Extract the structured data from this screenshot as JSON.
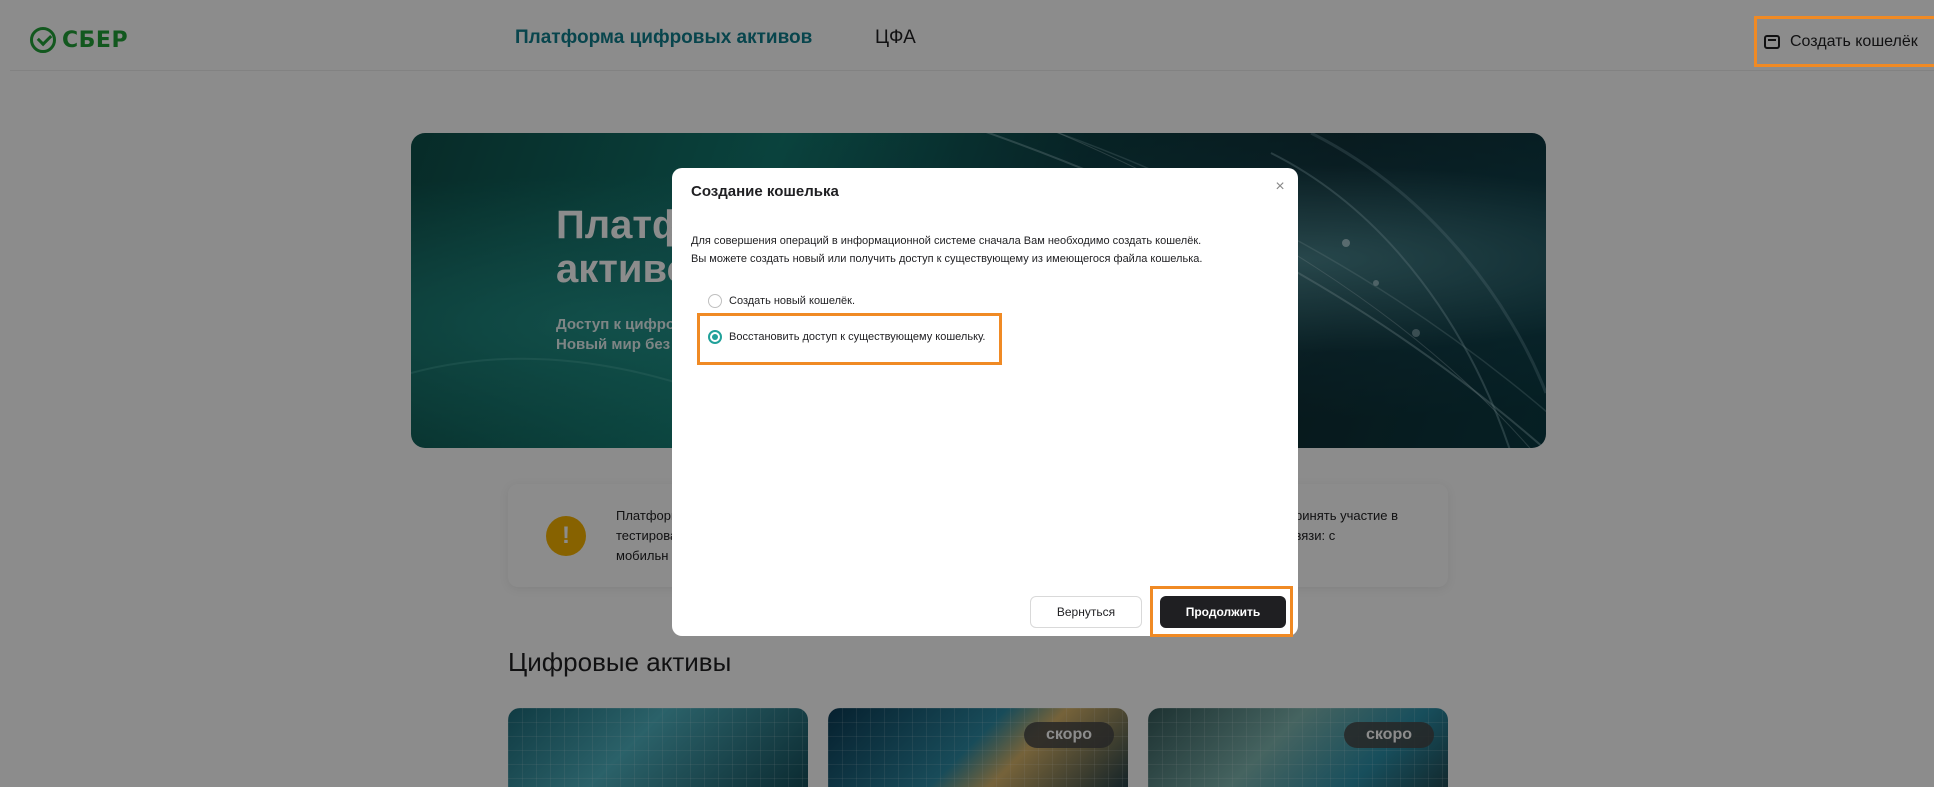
{
  "header": {
    "logo_text": "СБЕР",
    "nav_platform": "Платформа цифровых активов",
    "nav_cfa": "ЦФА",
    "create_wallet": "Создать кошелёк"
  },
  "hero": {
    "title": "Платформа цифровых\nактивов",
    "subtitle": "Доступ к цифровым активам.\nНовый мир без границ."
  },
  "notice": {
    "text_left": "Платформа\nтестирова\nмобильн",
    "text_right": "принять участие в\nсвязи: с"
  },
  "section": {
    "title": "Цифровые активы"
  },
  "cards": [
    {
      "badge": ""
    },
    {
      "badge": "скоро"
    },
    {
      "badge": "скоро"
    }
  ],
  "modal": {
    "title": "Создание кошелька",
    "close": "×",
    "description": "Для совершения операций в информационной системе сначала Вам необходимо создать кошелёк.\nВы можете создать новый или получить доступ к существующему из имеющегося файла кошелька.",
    "option_new": "Создать новый кошелёк.",
    "option_restore": "Восстановить доступ к существующему кошельку.",
    "btn_back": "Вернуться",
    "btn_continue": "Продолжить"
  },
  "colors": {
    "brand_green": "#21a038",
    "accent_teal": "#107f8c",
    "highlight_orange": "#f08a24",
    "radio_teal": "#21a19a"
  }
}
